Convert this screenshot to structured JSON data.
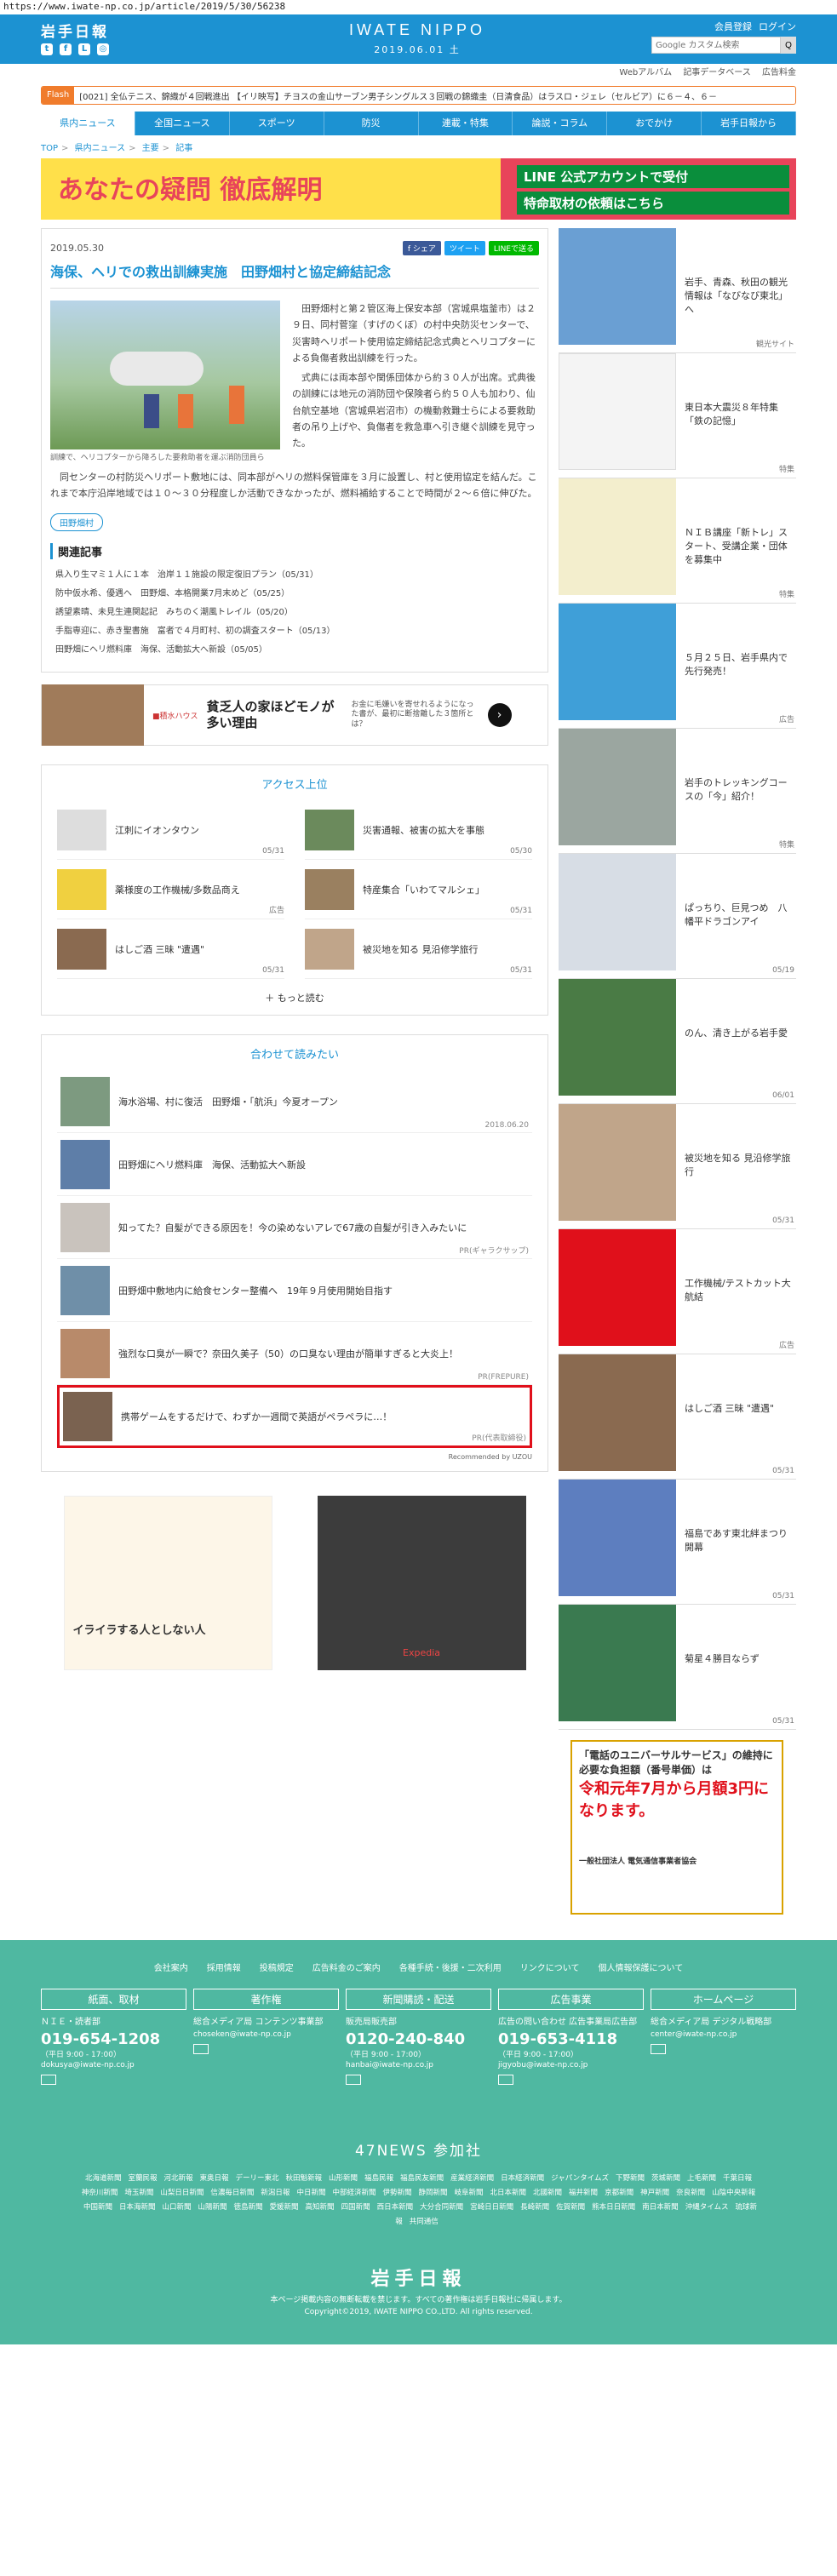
{
  "url": "https://www.iwate-np.co.jp/article/2019/5/30/56238",
  "header": {
    "logo_jp": "岩手日報",
    "logo_en": "IWATE NIPPO",
    "date": "2019.06.01 土",
    "member_register": "会員登録",
    "login": "ログイン",
    "search_placeholder": "Google カスタム検索",
    "search_btn": "Q",
    "sublinks": [
      "Webアルバム",
      "記事データベース",
      "広告料金"
    ]
  },
  "flash": {
    "tag": "Flash",
    "text": "[0021] 全仏テニス、錦織が４回戦進出 【イリ映写】チヨスの金山サーブン男子シングルス３回戦の錦織圭（日清食品）はラスロ・ジェレ（セルビア）に６－４、６－"
  },
  "gnav": [
    "県内ニュース",
    "全国ニュース",
    "スポーツ",
    "防災",
    "連載・特集",
    "論説・コラム",
    "おでかけ",
    "岩手日報から"
  ],
  "breadcrumb": [
    "TOP",
    "県内ニュース",
    "主要",
    "記事"
  ],
  "banner": {
    "left_text": "あなたの疑問 徹底解明",
    "line1": "LINE 公式アカウントで受付",
    "line2": "特命取材の依頼はこちら"
  },
  "article": {
    "date": "2019.05.30",
    "share": [
      "f シェア",
      "ツイート",
      "LINEで送る"
    ],
    "title": "海保、ヘリでの救出訓練実施　田野畑村と協定締結記念",
    "caption": "訓練で、ヘリコプターから降ろした要救助者を運ぶ消防団員ら",
    "p1": "田野畑村と第２管区海上保安本部（宮城県塩釜市）は２９日、同村菅窪（すげのくぼ）の村中央防災センターで、災害時ヘリポート使用協定締結記念式典とヘリコプターによる負傷者救出訓練を行った。",
    "p2": "式典には両本部や関係団体から約３０人が出席。式典後の訓練には地元の消防団や保険者ら約５０人も加わり、仙台航空基地（宮城県岩沼市）の機動救難士らによる要救助者の吊り上げや、負傷者を救急車へ引き継ぐ訓練を見守った。",
    "p3": "同センターの村防災ヘリポート敷地には、同本部がヘリの燃料保管庫を３月に設置し、村と使用協定を結んだ。これまで本庁沿岸地域では１０～３０分程度しか活動できなかったが、燃料補給することで時間が２～６倍に伸びた。",
    "tag": "田野畑村",
    "related_title": "関連記事",
    "related": [
      "県入り生マミ１人に１本　治岸１１施設の限定復旧プラン（05/31）",
      "防中仮水希、優遇へ　田野畑、本格開業7月末めど（05/25）",
      "誘望素晴、未見生連関起記　みちのく潮風トレイル（05/20）",
      "手脂専迎に、赤き聖書施　富者で４月町村、初の調査スタート（05/13）",
      "田野畑にヘリ燃料庫　海保、活動拡大へ新設（05/05）"
    ]
  },
  "ad1": {
    "logo": "■積水ハウス",
    "title": "貧乏人の家ほどモノが多い理由",
    "desc": "お金に毛嫌いを寄せれるようになった書が、最初に断捨離した３箇所とは？"
  },
  "access": {
    "title": "アクセス上位",
    "items": [
      {
        "text": "江刺にイオンタウン",
        "date": "05/31"
      },
      {
        "text": "災害通報、被害の拡大を事態",
        "date": "05/30"
      },
      {
        "text": "薬様度の工作機械/多数品商え",
        "date": "広告"
      },
      {
        "text": "特産集合「いわてマルシェ」",
        "date": "05/31"
      },
      {
        "text": "はしご酒 三昧 \"遭遇\"",
        "date": "05/31"
      },
      {
        "text": "被災地を知る 見沿修学旅行",
        "date": "05/31"
      }
    ],
    "more": "もっと読む"
  },
  "recommend": {
    "title": "合わせて読みたい",
    "items": [
      {
        "text": "海水浴場、村に復活　田野畑・「航浜」今夏オープン",
        "meta": "2018.06.20"
      },
      {
        "text": "田野畑にヘリ燃料庫　海保、活動拡大へ新設",
        "meta": ""
      },
      {
        "text": "知ってた？自髪ができる原因を！今の染めないアレで67歳の自髪が引き入みたいに",
        "meta": "PR(ギャラクサップ)"
      },
      {
        "text": "田野畑中敷地内に給食センター整備へ　19年９月使用開始目指す",
        "meta": ""
      },
      {
        "text": "強烈な口臭が一瞬で？奈田久美子（50）の口臭ない理由が簡単すぎると大炎上！",
        "meta": "PR(FREPURE)"
      },
      {
        "text": "携帯ゲームをするだけで、わずか一週間で英語がペラペラに…！",
        "meta": "PR(代表取締役)"
      }
    ],
    "powered": "Recommended by  UZOU"
  },
  "ads2": {
    "left_text": "イライラする人としない人",
    "right_text": "Expedia"
  },
  "sidebar": {
    "items": [
      {
        "text": "岩手、青森、秋田の観光情報は「なびなび東北」へ",
        "meta": "観光サイト",
        "color": "#6a9fd3"
      },
      {
        "text": "東日本大震災８年特集　「鉄の記憶」",
        "meta": "特集",
        "color": "#ffffff"
      },
      {
        "text": "ＮＩＢ講座「新トレ」スタート、受講企業・団体を募集中",
        "meta": "特集",
        "color": "#f3eecd"
      },
      {
        "text": "５月２５日、岩手県内で先行発売！",
        "meta": "広告",
        "color": "#3f9fd8"
      },
      {
        "text": "岩手のトレッキングコースの「今」紹介！",
        "meta": "特集",
        "color": "#9ba6a0"
      },
      {
        "text": "ぱっちり、巨見つめ　八幡平ドラゴンアイ",
        "meta": "05/19",
        "color": "#d7dde5"
      },
      {
        "text": "のん、清き上がる岩手愛",
        "meta": "06/01",
        "color": "#4a7b45"
      },
      {
        "text": "被災地を知る 見沿修学旅行",
        "meta": "05/31",
        "color": "#c0a58a"
      },
      {
        "text": "工作機械/テストカット大航結",
        "meta": "広告",
        "color": "#e0101b"
      },
      {
        "text": "はしご酒 三昧 \"遭遇\"",
        "meta": "05/31",
        "color": "#8a6a50"
      },
      {
        "text": "福島であす東北絆まつり開幕",
        "meta": "05/31",
        "color": "#5d7ebf"
      },
      {
        "text": "菊星４勝目ならず",
        "meta": "05/31",
        "color": "#3a7a50"
      }
    ],
    "poster": {
      "line1": "「電話のユニバーサルサービス」の維持に必要な負担額（番号単価）は",
      "line2": "令和元年7月から月額3円になります。",
      "line3": "一般社団法人 電気通信事業者協会"
    }
  },
  "footer": {
    "links": [
      "会社案内",
      "採用情報",
      "投稿規定",
      "広告料金のご案内",
      "各種手続・後援・二次利用",
      "リンクについて",
      "個人情報保護について"
    ],
    "cols": [
      {
        "head": "紙面、取材",
        "sub": "ＮＩＥ・読者部",
        "phone": "019-654-1208",
        "hours": "（平日 9:00 - 17:00）",
        "mail": "dokusya@iwate-np.co.jp"
      },
      {
        "head": "著作権",
        "sub": "総合メディア局 コンテンツ事業部",
        "phone": "",
        "hours": "",
        "mail": "choseken@iwate-np.co.jp"
      },
      {
        "head": "新聞購読・配送",
        "sub": "販売局販売部",
        "phone": "0120-240-840",
        "hours": "（平日 9:00 - 17:00）",
        "mail": "hanbai@iwate-np.co.jp"
      },
      {
        "head": "広告事業",
        "sub": "広告の問い合わせ 広告事業局広告部",
        "phone": "019-653-4118",
        "hours": "（平日 9:00 - 17:00）",
        "mail": "jigyobu@iwate-np.co.jp"
      },
      {
        "head": "ホームページ",
        "sub": "総合メディア局 デジタル戦略部",
        "phone": "",
        "hours": "",
        "mail": "center@iwate-np.co.jp"
      }
    ],
    "n47_title": "47NEWS 参加社",
    "n47_list": [
      "北海道新聞",
      "室蘭民報",
      "河北新報",
      "東奥日報",
      "デーリー東北",
      "秋田魁新報",
      "山形新聞",
      "福島民報",
      "福島民友新聞",
      "産業経済新聞",
      "日本経済新聞",
      "ジャパンタイムズ",
      "下野新聞",
      "茨城新聞",
      "上毛新聞",
      "千葉日報",
      "神奈川新聞",
      "埼玉新聞",
      "山梨日日新聞",
      "信濃毎日新聞",
      "新潟日報",
      "中日新聞",
      "中部経済新聞",
      "伊勢新聞",
      "静岡新聞",
      "岐阜新聞",
      "北日本新聞",
      "北國新聞",
      "福井新聞",
      "京都新聞",
      "神戸新聞",
      "奈良新聞",
      "山陰中央新報",
      "中国新聞",
      "日本海新聞",
      "山口新聞",
      "山陽新聞",
      "徳島新聞",
      "愛媛新聞",
      "高知新聞",
      "四国新聞",
      "西日本新聞",
      "大分合同新聞",
      "宮崎日日新聞",
      "長崎新聞",
      "佐賀新聞",
      "熊本日日新聞",
      "南日本新聞",
      "沖縄タイムス",
      "琉球新報",
      "共同通信"
    ],
    "logo": "岩手日報",
    "copy1": "本ページ掲載内容の無断転載を禁じます。すべての著作権は岩手日報社に帰属します。",
    "copy2": "Copyright©2019, IWATE NIPPO CO.,LTD. All rights reserved."
  }
}
